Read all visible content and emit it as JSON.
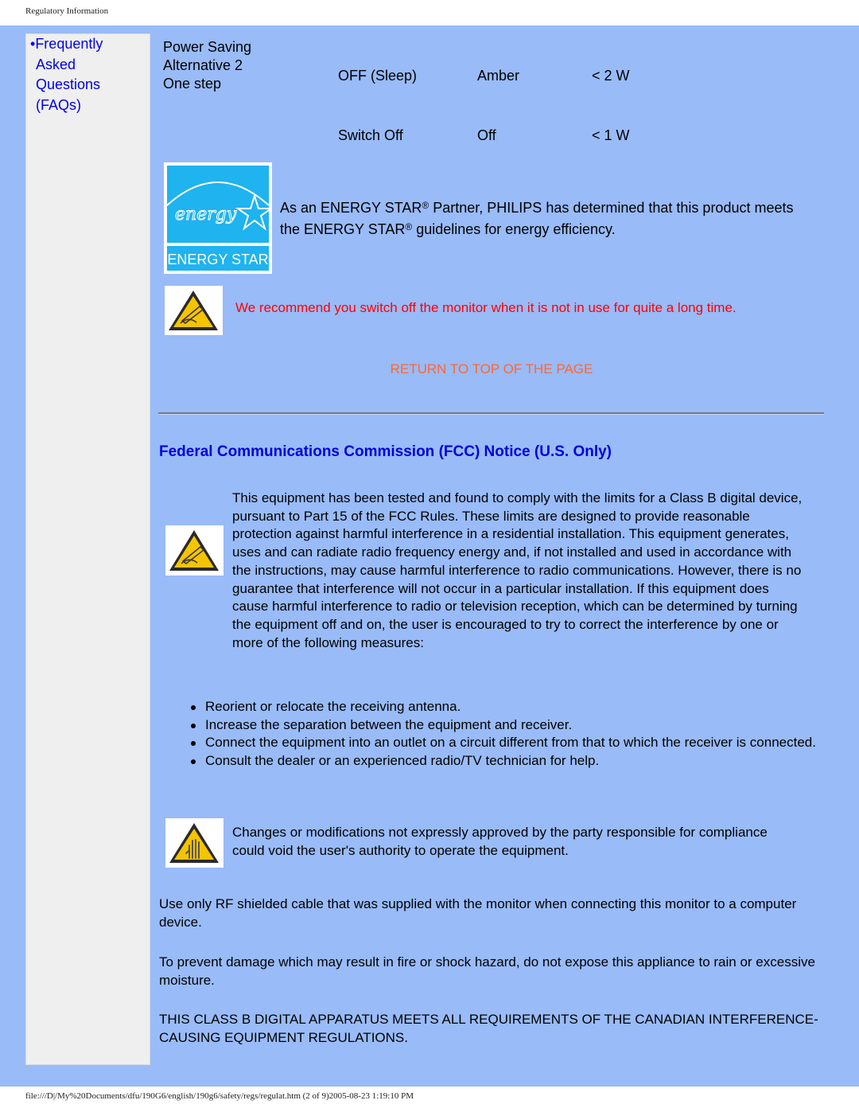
{
  "header": {
    "title": "Regulatory Information"
  },
  "sidebar": {
    "faq_link": {
      "bullet": "•",
      "line1": "Frequently",
      "line2": "Asked",
      "line3": "Questions",
      "line4": "(FAQs)"
    }
  },
  "power_table": {
    "mode_line1": "Power Saving",
    "mode_line2": "Alternative 2",
    "mode_line3": "One step",
    "rows": [
      {
        "state": "OFF (Sleep)",
        "led": "Amber",
        "power": "< 2 W"
      },
      {
        "state": "Switch Off",
        "led": "Off",
        "power": "< 1 W"
      }
    ]
  },
  "energy_star": {
    "logo_script": "energy",
    "logo_label": "ENERGY STAR",
    "text_part1": "As an ENERGY STAR",
    "reg_mark": "®",
    "text_part2": " Partner, PHILIPS has determined that this product meets the ENERGY STAR",
    "text_part3": " guidelines for energy efficiency."
  },
  "recommendation": "We recommend you switch off the monitor when it is not in use for quite a long time.",
  "return_link": "RETURN TO TOP OF THE PAGE",
  "fcc": {
    "title": "Federal Communications Commission (FCC) Notice (U.S. Only)",
    "paragraph": "This equipment has been tested and found to comply with the limits for a Class B digital device, pursuant to Part 15 of the FCC Rules. These limits are designed to provide reasonable protection against harmful interference in a residential installation. This equipment generates, uses and can radiate radio frequency energy and, if not installed and used in accordance with the instructions, may cause harmful interference to radio communications. However, there is no guarantee that interference will not occur in a particular installation. If this equipment does cause harmful interference to radio or television reception, which can be determined by turning the equipment off and on, the user is encouraged to try to correct the interference by one or more of the following measures:",
    "measures": [
      "Reorient or relocate the receiving antenna.",
      "Increase the separation between the equipment and receiver.",
      "Connect the equipment into an outlet on a circuit different from that to which the receiver is connected.",
      "Consult the dealer or an experienced radio/TV technician for help."
    ],
    "changes_warning": "Changes or modifications not expressly approved by the party responsible for compliance could void the user's authority to operate the equipment.",
    "rf_cable": "Use only RF shielded cable that was supplied with the monitor when connecting this monitor to a computer device.",
    "moisture": "To prevent damage which may result in fire or shock hazard, do not expose this appliance to rain or excessive moisture.",
    "canadian": "THIS CLASS B DIGITAL APPARATUS MEETS ALL REQUIREMENTS OF THE CANADIAN INTERFERENCE-CAUSING EQUIPMENT REGULATIONS."
  },
  "footer": {
    "text": "file:///D|/My%20Documents/dfu/190G6/english/190g6/safety/regs/regulat.htm (2 of 9)2005-08-23 1:19:10 PM"
  },
  "colors": {
    "page_background": "#99bbf8",
    "sidebar_background": "#efefef",
    "link_blue": "#0000ee",
    "heading_blue": "#0000dd",
    "warning_red": "#ff0000",
    "return_orange": "#ff6633",
    "energy_star_cyan": "#1fb3ef"
  }
}
